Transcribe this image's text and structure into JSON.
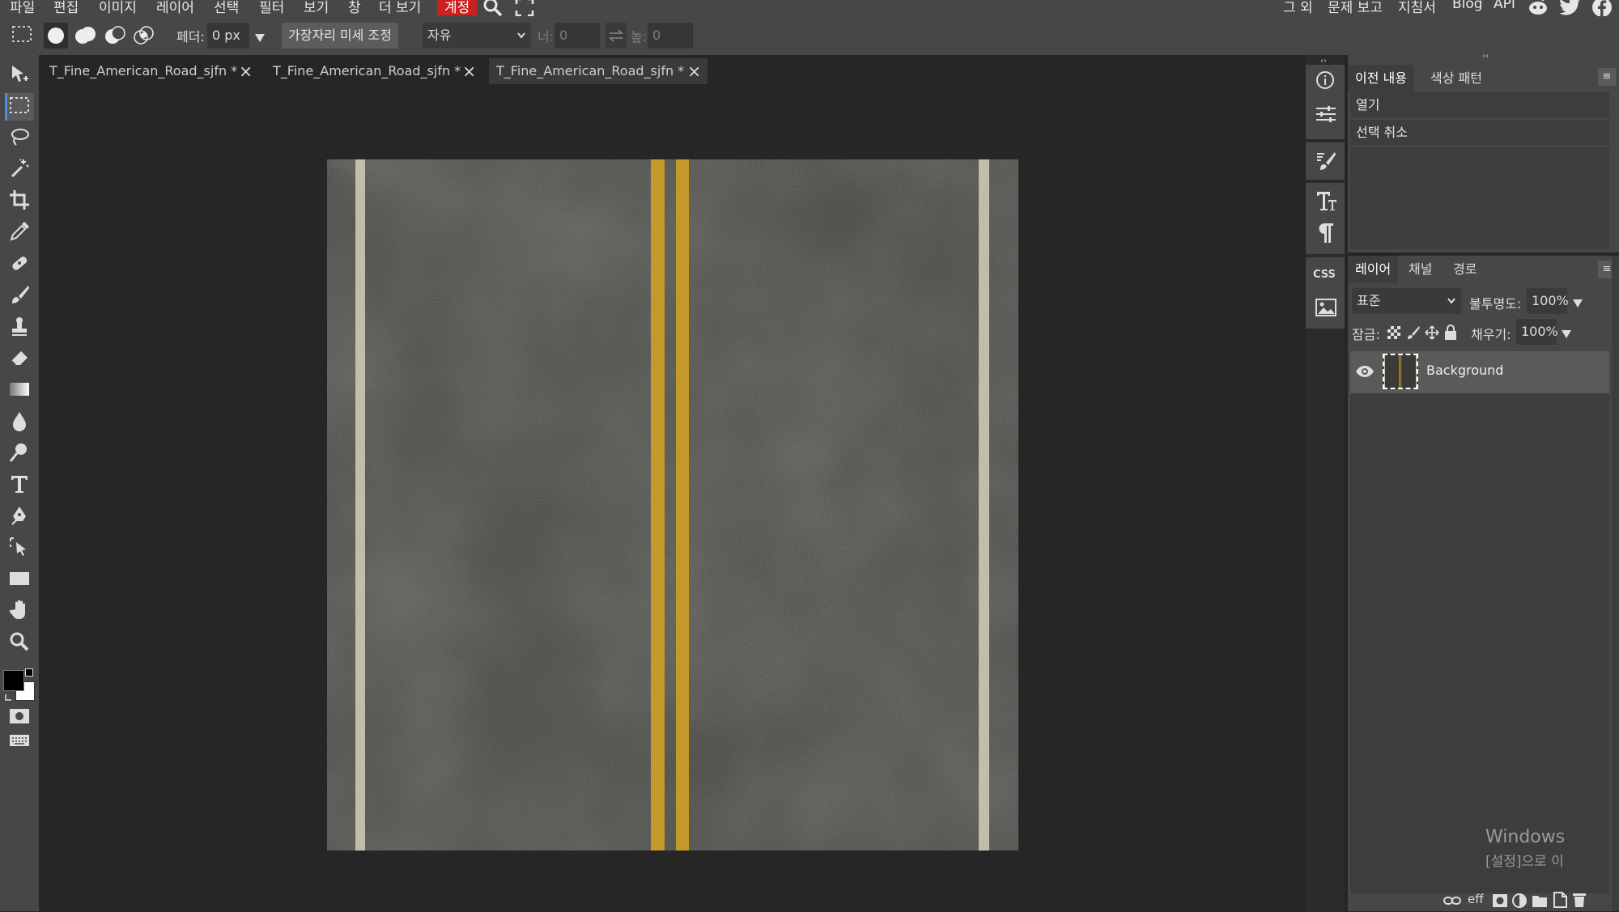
{
  "menu": {
    "items": [
      "파일",
      "편집",
      "이미지",
      "레이어",
      "선택",
      "필터",
      "보기",
      "창",
      "더 보기"
    ],
    "account": "계정",
    "right_items": [
      "그 외",
      "문제 보고",
      "지침서",
      "Blog",
      "API"
    ]
  },
  "options": {
    "feather_label": "페더:",
    "feather_value": "0 px",
    "refine_edge": "가장자리 미세 조정",
    "mode": "자유",
    "width_label": "너:",
    "width_value": "0",
    "height_label": "높:",
    "height_value": "0"
  },
  "tabs": [
    {
      "title": "T_Fine_American_Road_sjfn *"
    },
    {
      "title": "T_Fine_American_Road_sjfn *"
    },
    {
      "title": "T_Fine_American_Road_sjfn *"
    }
  ],
  "history_panel": {
    "tabs": [
      "이전 내용",
      "색상 패턴"
    ],
    "items": [
      "열기",
      "선택 취소"
    ]
  },
  "layers_panel": {
    "tabs": [
      "레이어",
      "채널",
      "경로"
    ],
    "blend_mode": "표준",
    "opacity_label": "불투명도:",
    "opacity_value": "100%",
    "lock_label": "잠금:",
    "fill_label": "채우기:",
    "fill_value": "100%",
    "layers": [
      {
        "name": "Background"
      }
    ]
  },
  "strip": {
    "css_label": "CSS"
  },
  "watermark": {
    "line1": "Windows",
    "line2": "[설정]으로 이"
  },
  "footer": {
    "eff_label": "eff"
  },
  "colors": {
    "accent": "#cc1f1f",
    "asphalt": "#3b3a36",
    "yellow_line": "#c6951c",
    "white_line": "#c9c6b3"
  },
  "icons": [
    "select-arrow-icon",
    "rect-select-icon",
    "lasso-icon",
    "magic-wand-icon",
    "crop-icon",
    "eyedropper-icon",
    "healing-icon",
    "brush-icon",
    "stamp-icon",
    "eraser-icon",
    "gradient-icon",
    "blur-icon",
    "dodge-icon",
    "text-icon",
    "pen-icon",
    "path-select-icon",
    "shape-icon",
    "hand-icon",
    "zoom-icon"
  ]
}
